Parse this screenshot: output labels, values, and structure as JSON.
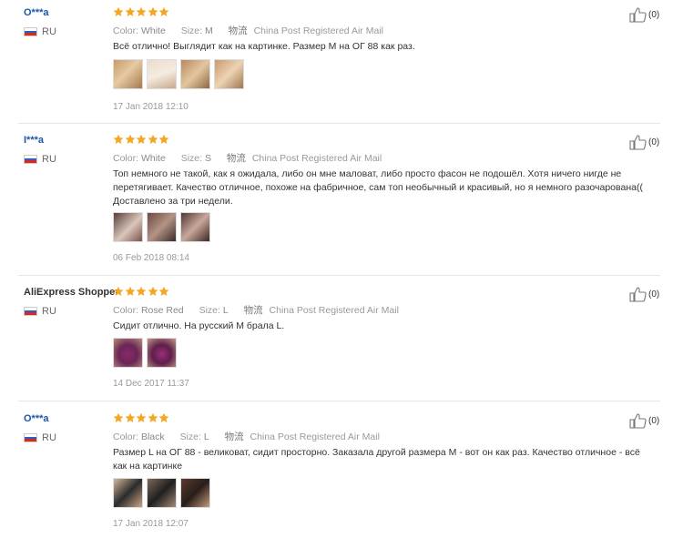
{
  "reviews": [
    {
      "author": "O***a",
      "country": "RU",
      "color_label": "Color:",
      "color": "White",
      "size_label": "Size:",
      "size": "M",
      "shipping_label": "物流",
      "shipping": "China Post Registered Air Mail",
      "text": "Всё отлично! Выглядит как на картинке. Размер M на ОГ 88 как раз.",
      "photos": [
        "photo-1",
        "photo-2",
        "photo-3",
        "photo-4"
      ],
      "date": "17 Jan 2018 12:10",
      "helpful": "(0)"
    },
    {
      "author": "I***a",
      "country": "RU",
      "color_label": "Color:",
      "color": "White",
      "size_label": "Size:",
      "size": "S",
      "shipping_label": "物流",
      "shipping": "China Post Registered Air Mail",
      "text": "Топ немного не такой, как я ожидала, либо он мне маловат, либо просто фасон не подошёл. Хотя ничего нигде не перетягивает. Качество отличное, похоже на фабричное, сам топ необычный и красивый, но я немного разочарована(( Доставлено за три недели.",
      "photos": [
        "photo-1",
        "photo-2",
        "photo-3"
      ],
      "date": "06 Feb 2018 08:14",
      "helpful": "(0)"
    },
    {
      "author": "AliExpress Shopper",
      "country": "RU",
      "color_label": "Color:",
      "color": "Rose Red",
      "size_label": "Size:",
      "size": "L",
      "shipping_label": "物流",
      "shipping": "China Post Registered Air Mail",
      "text": "Сидит отлично. На русский M брала L.",
      "photos": [
        "photo-1",
        "photo-2"
      ],
      "date": "14 Dec 2017 11:37",
      "helpful": "(0)"
    },
    {
      "author": "O***a",
      "country": "RU",
      "color_label": "Color:",
      "color": "Black",
      "size_label": "Size:",
      "size": "L",
      "shipping_label": "物流",
      "shipping": "China Post Registered Air Mail",
      "text": "Размер L на ОГ 88 - великоват, сидит просторно. Заказала другой размера M - вот он как раз. Качество отличное - всё как на картинке",
      "photos": [
        "photo-1",
        "photo-2",
        "photo-3"
      ],
      "date": "17 Jan 2018 12:07",
      "helpful": "(0)"
    }
  ],
  "rating_stars": 5,
  "colors": {
    "star": "#f5a623",
    "author_link": "#1a56a8",
    "flag_white": "#ffffff",
    "flag_blue": "#2e5cc8",
    "flag_red": "#d52b1e",
    "divider": "#e6e6e6"
  },
  "icons": {
    "star": "star-icon",
    "thumbs_up": "thumbs-up-icon",
    "flag": "russia-flag-icon"
  }
}
